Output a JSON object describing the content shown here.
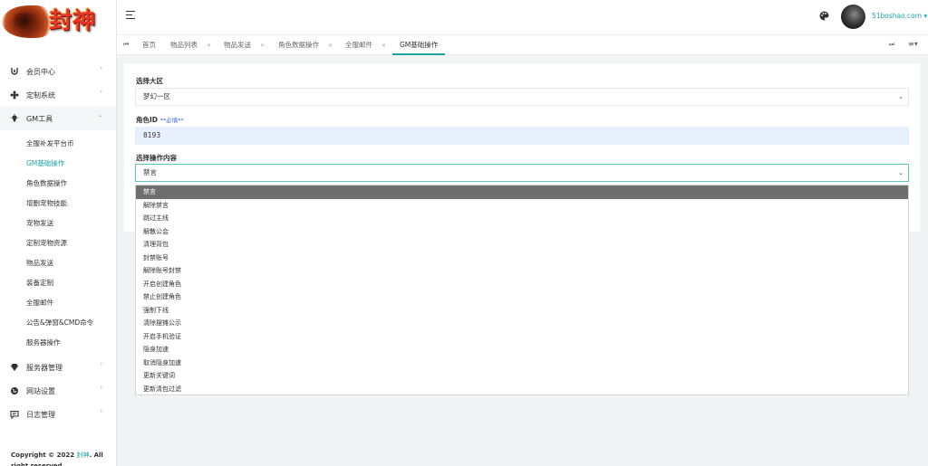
{
  "logo": {
    "text": "封神"
  },
  "header": {
    "username": "51boshao.com"
  },
  "sidebar": {
    "menu": [
      {
        "label": "会员中心",
        "icon": "user-icon"
      },
      {
        "label": "定制系统",
        "icon": "puzzle-icon"
      },
      {
        "label": "GM工具",
        "icon": "bulb-icon"
      }
    ],
    "submenu": [
      "全服补发平台币",
      "GM基础操作",
      "角色数据操作",
      "增删宠物技能",
      "宠物发送",
      "定制宠物资源",
      "物品发送",
      "装备定制",
      "全服邮件",
      "公告&弹窗&CMD命令",
      "服务器操作"
    ],
    "menu_bottom": [
      {
        "label": "服务器管理",
        "icon": "diamond-icon"
      },
      {
        "label": "网站设置",
        "icon": "globe-icon"
      },
      {
        "label": "日志管理",
        "icon": "comment-icon"
      }
    ],
    "footer": {
      "prefix": "Copyright © 2022",
      "brand": "封神",
      "suffix": ". All right reserved"
    }
  },
  "tabs": [
    {
      "label": "首页",
      "closable": false
    },
    {
      "label": "物品列表",
      "closable": true
    },
    {
      "label": "物品发送",
      "closable": true
    },
    {
      "label": "角色数据操作",
      "closable": true
    },
    {
      "label": "全服邮件",
      "closable": true
    },
    {
      "label": "GM基础操作",
      "closable": false
    }
  ],
  "form": {
    "region_label": "选择大区",
    "region_value": "梦幻一区",
    "role_label": "角色ID",
    "role_required": "**必填**",
    "role_value": "8193",
    "op_label": "选择操作内容",
    "op_value": "禁言"
  },
  "dropdown_options": [
    "禁言",
    "解除禁言",
    "跳过主线",
    "解散公会",
    "清理背包",
    "封禁账号",
    "解除账号封禁",
    "开启创建角色",
    "禁止创建角色",
    "强制下线",
    "清除摆摊公示",
    "开启手机验证",
    "隐身加速",
    "取消隐身加速",
    "更新关键词",
    "更新清包过滤"
  ],
  "colors": {
    "accent": "#1aa6a6",
    "required": "#3d63d6"
  }
}
